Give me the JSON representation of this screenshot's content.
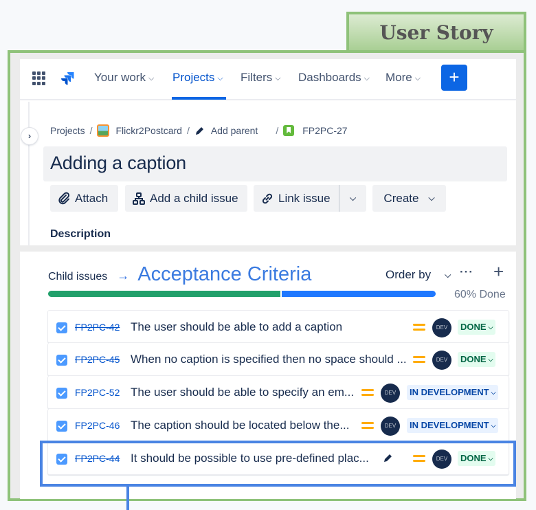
{
  "annotations": {
    "user_story_label": "User Story",
    "child_issues_arrow": "→",
    "acceptance_criteria_label": "Acceptance Criteria",
    "colors": {
      "user_story_green": "#8fc27a",
      "highlight_blue": "#4a84e3"
    }
  },
  "topnav": {
    "items": [
      {
        "label": "Your work",
        "active": false
      },
      {
        "label": "Projects",
        "active": true
      },
      {
        "label": "Filters",
        "active": false
      },
      {
        "label": "Dashboards",
        "active": false
      },
      {
        "label": "More",
        "active": false
      }
    ],
    "create_label": "+",
    "chevron": "⌄"
  },
  "breadcrumb": {
    "projects": "Projects",
    "project_name": "Flickr2Postcard",
    "add_parent": "Add parent",
    "issue_key": "FP2PC-27",
    "separator": "/"
  },
  "issue": {
    "title": "Adding a caption",
    "actions": {
      "attach": "Attach",
      "add_child": "Add a child issue",
      "link_issue": "Link issue",
      "create": "Create"
    },
    "description_label": "Description"
  },
  "child_issues": {
    "label": "Child issues",
    "order_by": "Order by",
    "more": "···",
    "add": "+",
    "progress": {
      "done_fraction": 0.6,
      "label": "60% Done"
    },
    "colors": {
      "done": "#22a06b",
      "in_progress": "#1f78ff"
    },
    "rows": [
      {
        "key": "FP2PC-42",
        "summary": "The user should be able to add a caption",
        "priority": "medium",
        "assignee": "DEV",
        "status": "DONE",
        "resolved": true
      },
      {
        "key": "FP2PC-45",
        "summary": "When no caption is specified then no space should ...",
        "priority": "medium",
        "assignee": "DEV",
        "status": "DONE",
        "resolved": true
      },
      {
        "key": "FP2PC-52",
        "summary": "The user should be able to specify an em...",
        "priority": "medium",
        "assignee": "DEV",
        "status": "IN DEVELOPMENT",
        "resolved": false
      },
      {
        "key": "FP2PC-46",
        "summary": "The caption should be located below the...",
        "priority": "medium",
        "assignee": "DEV",
        "status": "IN DEVELOPMENT",
        "resolved": false
      },
      {
        "key": "FP2PC-44",
        "summary": "It should be possible to use pre-defined plac...",
        "priority": "medium",
        "assignee": "DEV",
        "status": "DONE",
        "resolved": true,
        "editing": true
      }
    ]
  }
}
